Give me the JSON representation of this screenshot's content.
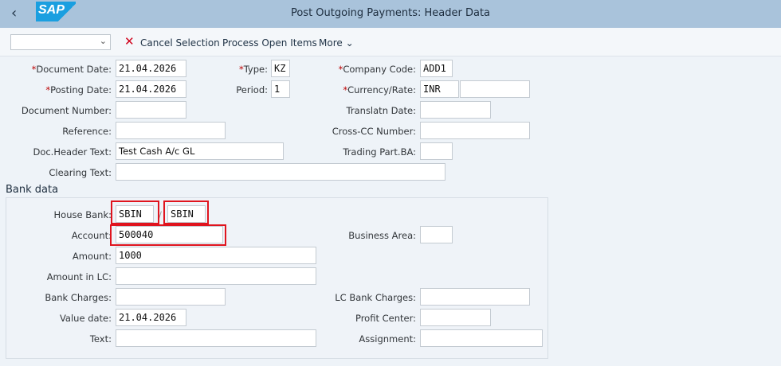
{
  "header": {
    "title": "Post Outgoing Payments: Header Data",
    "logo": "SAP",
    "back_icon": "chevron-left-icon"
  },
  "toolbar": {
    "dropdown_value": "",
    "cancel_label": "Cancel Selection",
    "process_label": "Process Open Items",
    "more_label": "More"
  },
  "header_data": {
    "document_date": {
      "label": "Document Date:",
      "value": "21.04.2026"
    },
    "posting_date": {
      "label": "Posting Date:",
      "value": "21.04.2026"
    },
    "document_number": {
      "label": "Document Number:",
      "value": ""
    },
    "reference": {
      "label": "Reference:",
      "value": ""
    },
    "doc_header_text": {
      "label": "Doc.Header Text:",
      "value": "Test Cash A/c GL"
    },
    "clearing_text": {
      "label": "Clearing Text:",
      "value": ""
    },
    "type": {
      "label": "Type:",
      "value": "KZ"
    },
    "period": {
      "label": "Period:",
      "value": "1"
    },
    "company_code": {
      "label": "Company Code:",
      "value": "ADD1"
    },
    "currency": {
      "label": "Currency/Rate:",
      "value": "INR",
      "rate": ""
    },
    "translatn_date": {
      "label": "Translatn Date:",
      "value": ""
    },
    "cross_cc": {
      "label": "Cross-CC Number:",
      "value": ""
    },
    "trading_part": {
      "label": "Trading Part.BA:",
      "value": ""
    }
  },
  "bank_data": {
    "title": "Bank data",
    "house_bank": {
      "label": "House Bank:",
      "value": "SBIN",
      "account_id": "SBIN",
      "separator": "/"
    },
    "account": {
      "label": "Account:",
      "value": "500040"
    },
    "amount": {
      "label": "Amount:",
      "value": "1000"
    },
    "amount_lc": {
      "label": "Amount in LC:",
      "value": ""
    },
    "bank_charges": {
      "label": "Bank Charges:",
      "value": ""
    },
    "value_date": {
      "label": "Value date:",
      "value": "21.04.2026"
    },
    "text": {
      "label": "Text:",
      "value": ""
    },
    "business_area": {
      "label": "Business Area:",
      "value": ""
    },
    "lc_bank_charges": {
      "label": "LC Bank Charges:",
      "value": ""
    },
    "profit_center": {
      "label": "Profit Center:",
      "value": ""
    },
    "assignment": {
      "label": "Assignment:",
      "value": ""
    }
  },
  "colors": {
    "header": "#a9c3db",
    "highlight": "#e0141e",
    "background": "#eef3f8"
  }
}
